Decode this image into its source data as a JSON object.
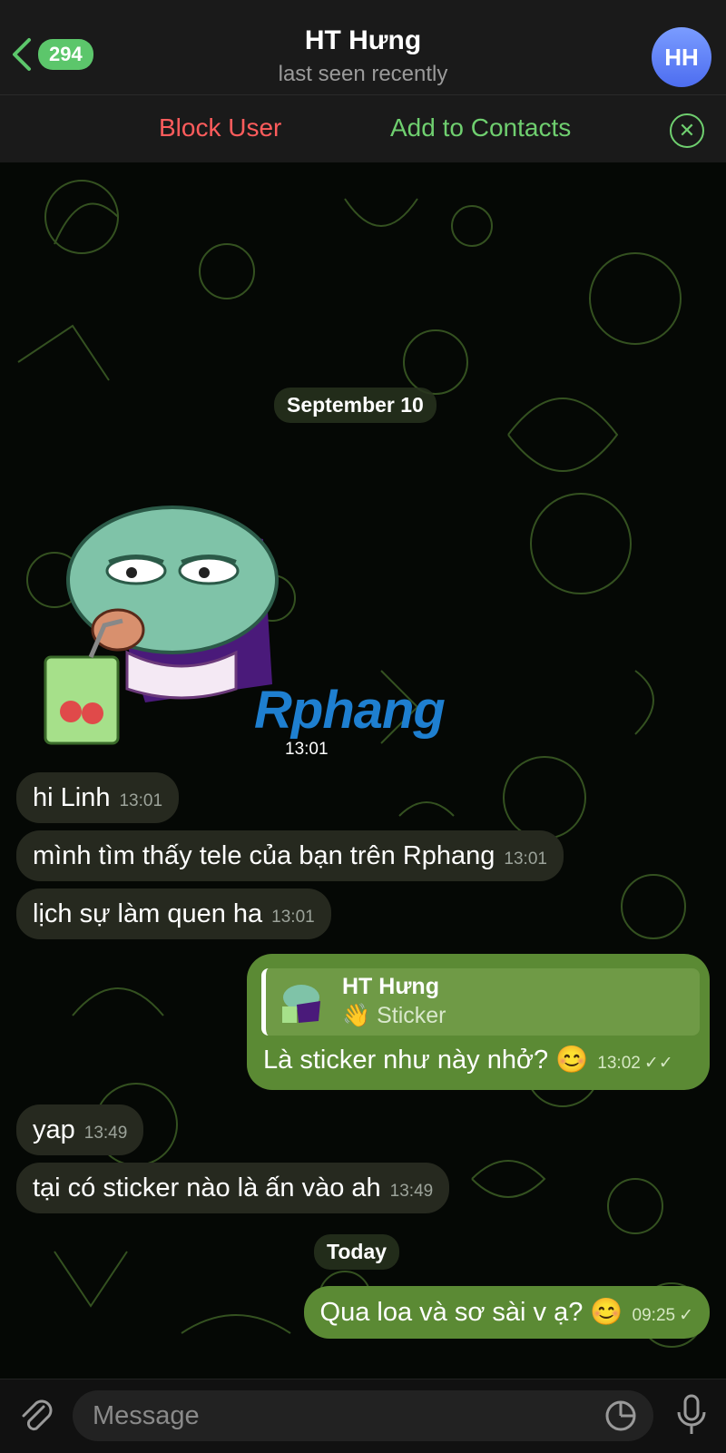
{
  "header": {
    "back_count": "294",
    "name": "HT Hưng",
    "status": "last seen recently",
    "avatar_initials": "HH"
  },
  "actions": {
    "block": "Block User",
    "add": "Add to Contacts"
  },
  "chat": {
    "date1": "September 10",
    "sticker_time": "13:01",
    "watermark": "Rphang",
    "incoming1": [
      {
        "text": "hi Linh",
        "time": "13:01"
      },
      {
        "text": "mình tìm thấy tele của bạn trên Rphang",
        "time": "13:01"
      },
      {
        "text": "lịch sự làm quen ha",
        "time": "13:01"
      }
    ],
    "outgoing1": {
      "reply_name": "HT Hưng",
      "reply_preview": "👋 Sticker",
      "text": "Là sticker như này nhở? 😊",
      "time": "13:02"
    },
    "incoming2": [
      {
        "text": "yap",
        "time": "13:49"
      },
      {
        "text": "tại có sticker nào là ấn vào ah",
        "time": "13:49"
      }
    ],
    "date2": "Today",
    "outgoing2": {
      "text": "Qua loa và sơ sài v ạ? 😊",
      "time": "09:25"
    }
  },
  "input": {
    "placeholder": "Message"
  },
  "colors": {
    "accent_green": "#5cc66b",
    "danger": "#ff5c5c",
    "out_bubble": "#5b8a34"
  }
}
